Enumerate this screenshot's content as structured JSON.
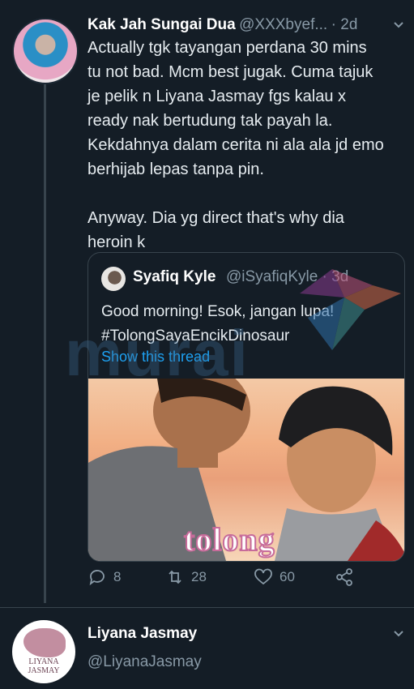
{
  "tweet": {
    "author_name": "Kak Jah Sungai Dua",
    "handle": "@XXXbyef...",
    "time": "· 2d",
    "text": "Actually tgk tayangan perdana 30 mins\ntu not bad. Mcm best jugak. Cuma tajuk\nje pelik n Liyana Jasmay fgs kalau x\nready nak bertudung tak payah la.\nKekdahnya dalam cerita ni ala ala jd emo\nberhijab lepas tanpa pin.\n\nAnyway. Dia yg direct that's why dia\nheroin k"
  },
  "quote": {
    "author_name": "Syafiq Kyle",
    "handle": "@iSyafiqKyle · 3d",
    "text": "Good morning! Esok, jangan lupa!\n#TolongSayaEncikDinosaur",
    "show_thread": "Show this thread",
    "media_logo": "tolong"
  },
  "actions": {
    "replies": "8",
    "retweets": "28",
    "likes": "60"
  },
  "next_tweet": {
    "author_name": "Liyana Jasmay",
    "handle": "@LiyanaJasmay",
    "avatar_text": "LIYANA\nJASMAY"
  },
  "watermark": "murai",
  "colors": {
    "background": "#141d26",
    "link": "#1da1f2",
    "muted": "#8899a6",
    "border": "#38444d"
  }
}
